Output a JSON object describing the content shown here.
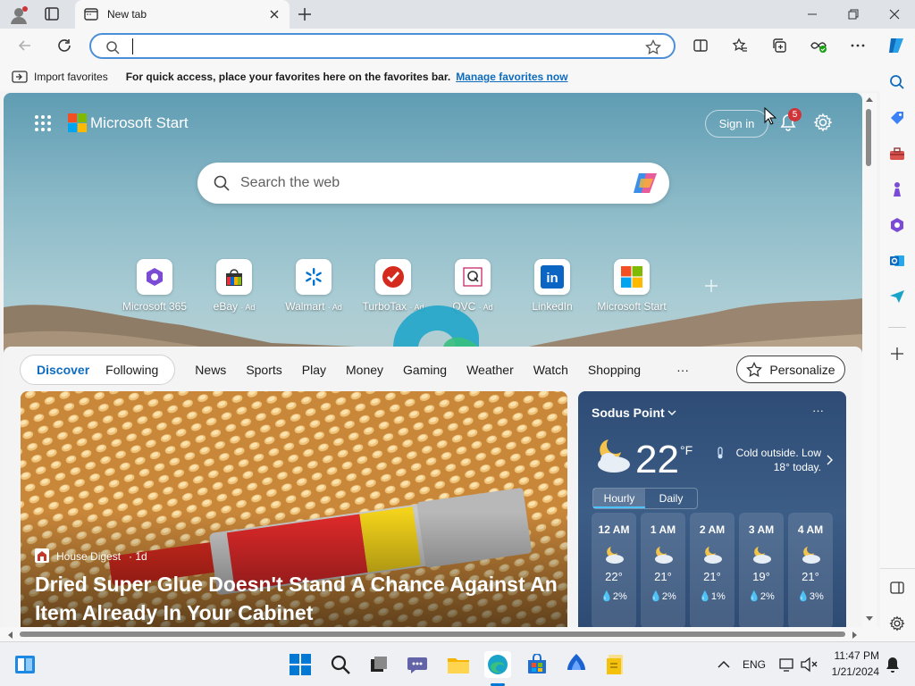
{
  "browser": {
    "tab_title": "New tab",
    "address_value": "",
    "favorites_bar": {
      "import_label": "Import favorites",
      "message": "For quick access, place your favorites here on the favorites bar.",
      "manage_link": "Manage favorites now"
    }
  },
  "start": {
    "brand": "Microsoft Start",
    "sign_in": "Sign in",
    "notification_count": "5",
    "search_placeholder": "Search the web",
    "quick_links": [
      {
        "label": "Microsoft 365",
        "ad": ""
      },
      {
        "label": "eBay",
        "ad": "· Ad"
      },
      {
        "label": "Walmart",
        "ad": "· Ad"
      },
      {
        "label": "TurboTax",
        "ad": "· Ad"
      },
      {
        "label": "QVC",
        "ad": "· Ad"
      },
      {
        "label": "LinkedIn",
        "ad": ""
      },
      {
        "label": "Microsoft Start",
        "ad": ""
      }
    ],
    "feed_tabs": {
      "pill": [
        "Discover",
        "Following"
      ],
      "items": [
        "News",
        "Sports",
        "Play",
        "Money",
        "Gaming",
        "Weather",
        "Watch",
        "Shopping"
      ],
      "more": "···",
      "personalize": "Personalize"
    },
    "article": {
      "source": "House Digest",
      "age": "· 1d",
      "title": "Dried Super Glue Doesn't Stand A Chance Against An Item Already In Your Cabinet"
    },
    "weather": {
      "location": "Sodus Point",
      "temp": "22",
      "unit": "°F",
      "summary": "Cold outside. Low 18° today.",
      "tabs": [
        "Hourly",
        "Daily"
      ],
      "more": "···",
      "hourly": [
        {
          "time": "12 AM",
          "temp": "22°",
          "precip": "2%"
        },
        {
          "time": "1 AM",
          "temp": "21°",
          "precip": "2%"
        },
        {
          "time": "2 AM",
          "temp": "21°",
          "precip": "1%"
        },
        {
          "time": "3 AM",
          "temp": "19°",
          "precip": "2%"
        },
        {
          "time": "4 AM",
          "temp": "21°",
          "precip": "3%"
        }
      ]
    }
  },
  "taskbar": {
    "lang": "ENG",
    "time": "11:47 PM",
    "date": "1/21/2024"
  },
  "colors": {
    "accent": "#0f6cbd",
    "badge": "#d13438"
  }
}
